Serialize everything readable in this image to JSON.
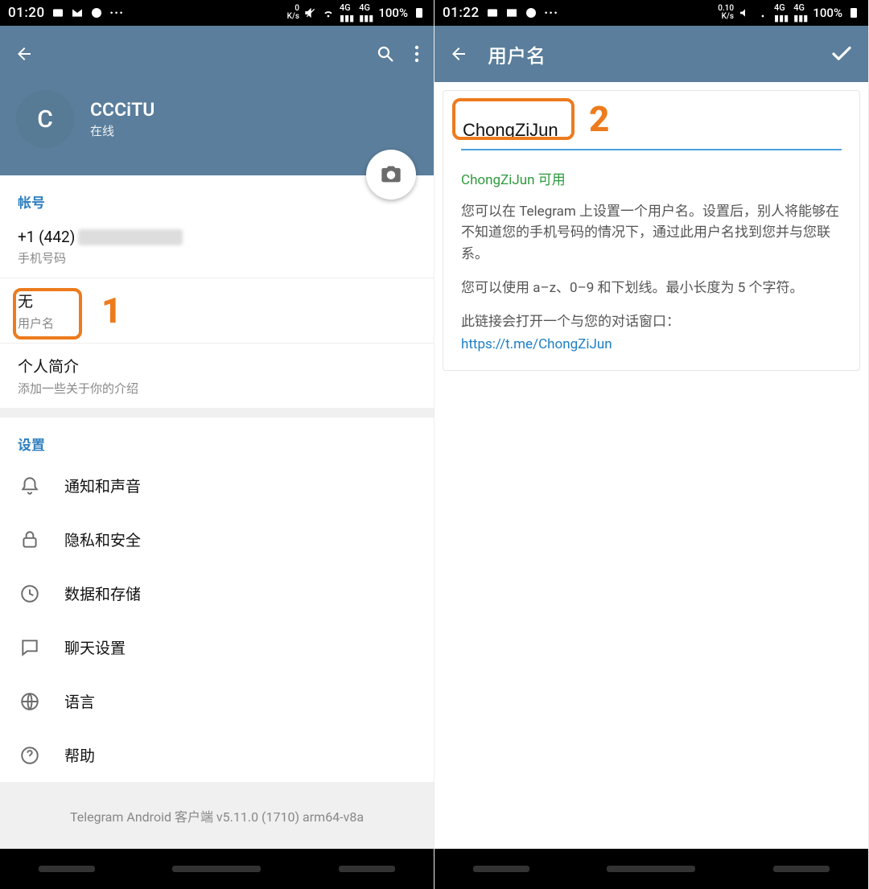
{
  "colors": {
    "appbar": "#5a7e9b",
    "accent": "#2f7fbf",
    "annotation": "#ed7b1d"
  },
  "left": {
    "status": {
      "time": "01:20",
      "net_rate": "0",
      "net_unit": "K/s",
      "battery": "100%"
    },
    "profile": {
      "avatar_initial": "C",
      "name": "CCCiTU",
      "status": "在线"
    },
    "account": {
      "header": "帐号",
      "phone_prefix": "+1 (442)",
      "phone_label": "手机号码",
      "username_value": "无",
      "username_label": "用户名",
      "bio_title": "个人简介",
      "bio_sub": "添加一些关于你的介绍"
    },
    "settings": {
      "header": "设置",
      "items": [
        {
          "icon": "bell",
          "label": "通知和声音"
        },
        {
          "icon": "lock",
          "label": "隐私和安全"
        },
        {
          "icon": "clock",
          "label": "数据和存储"
        },
        {
          "icon": "chat",
          "label": "聊天设置"
        },
        {
          "icon": "globe",
          "label": "语言"
        },
        {
          "icon": "help",
          "label": "帮助"
        }
      ]
    },
    "version": "Telegram Android 客户端 v5.11.0 (1710) arm64-v8a",
    "annotation_number": "1"
  },
  "right": {
    "status": {
      "time": "01:22",
      "net_rate": "0.10",
      "net_unit": "K/s",
      "battery": "100%"
    },
    "title": "用户名",
    "username_value": "ChongZiJun",
    "available_text": "ChongZiJun 可用",
    "desc1": "您可以在 Telegram 上设置一个用户名。设置后，别人将能够在不知道您的手机号码的情况下，通过此用户名找到您并与您联系。",
    "desc2": "您可以使用 a–z、0–9 和下划线。最小长度为 5 个字符。",
    "desc3": "此链接会打开一个与您的对话窗口：",
    "link": "https://t.me/ChongZiJun",
    "annotation_number": "2"
  }
}
